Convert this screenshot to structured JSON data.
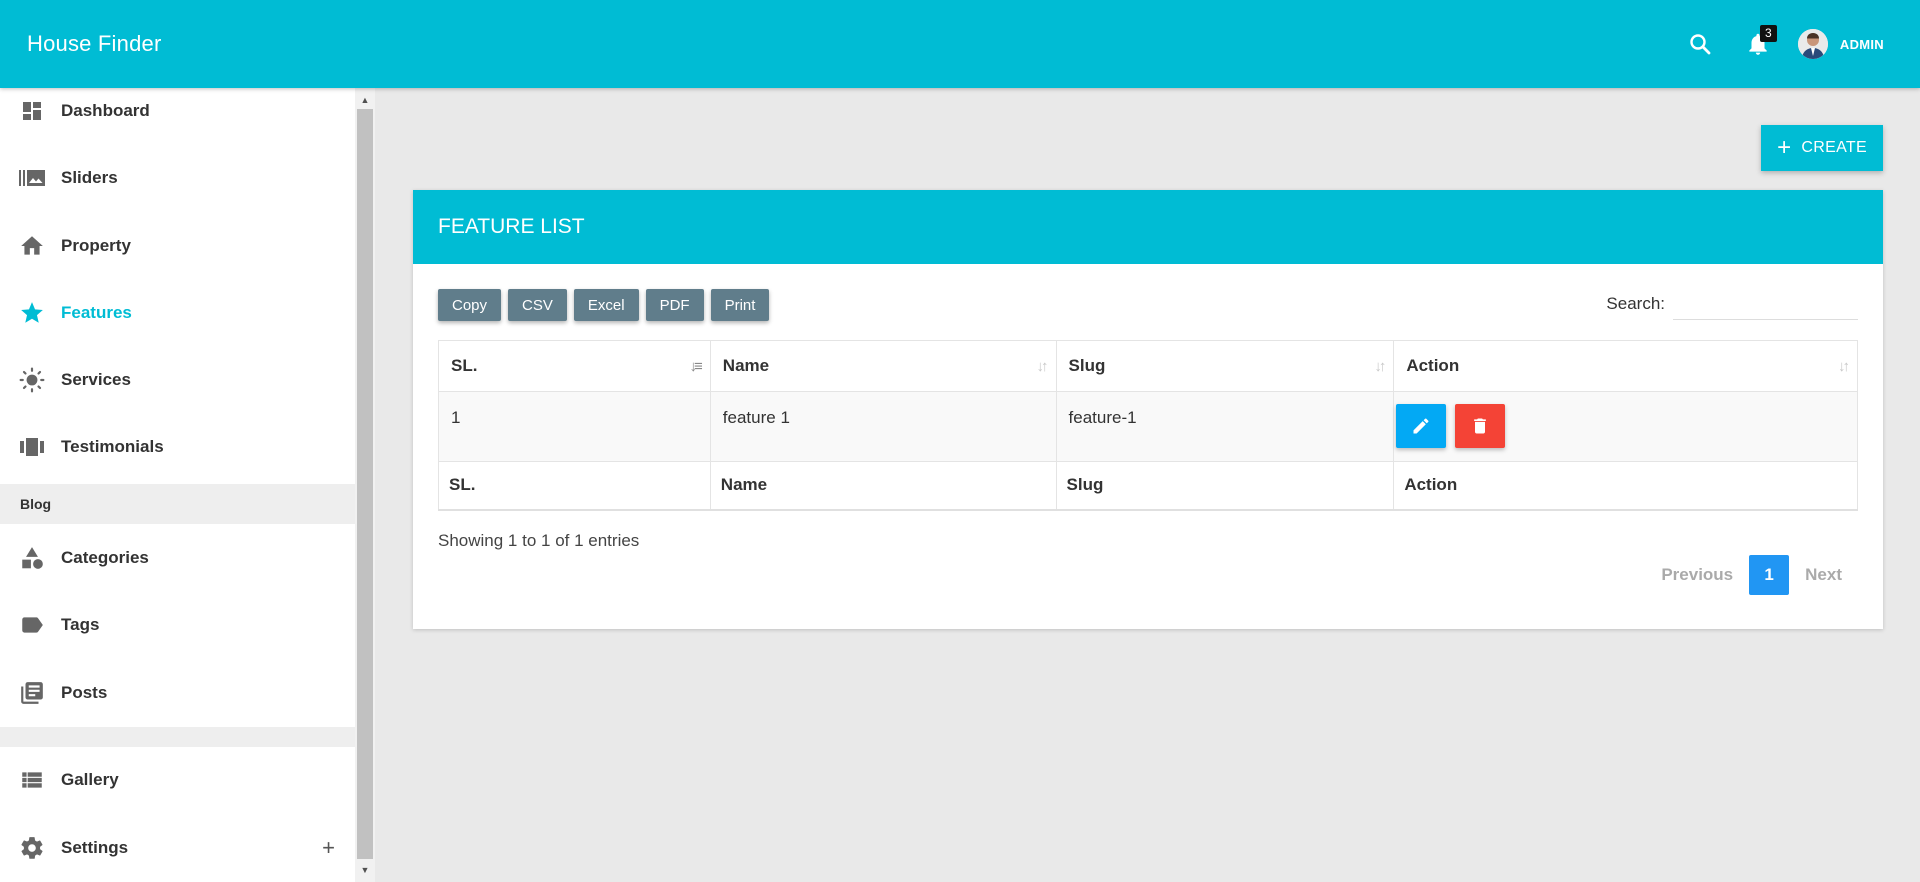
{
  "app": {
    "title": "House Finder"
  },
  "topbar": {
    "notification_count": "3",
    "user_label": "ADMIN"
  },
  "sidebar": {
    "items": [
      {
        "label": "Dashboard",
        "icon": "dashboard-icon"
      },
      {
        "label": "Sliders",
        "icon": "slider-icon"
      },
      {
        "label": "Property",
        "icon": "home-icon"
      },
      {
        "label": "Features",
        "icon": "star-icon",
        "active": true
      },
      {
        "label": "Services",
        "icon": "sun-icon"
      },
      {
        "label": "Testimonials",
        "icon": "carousel-icon"
      }
    ],
    "blog_header": "Blog",
    "blog_items": [
      {
        "label": "Categories",
        "icon": "category-icon"
      },
      {
        "label": "Tags",
        "icon": "tag-icon"
      },
      {
        "label": "Posts",
        "icon": "library-icon"
      }
    ],
    "bottom_items": [
      {
        "label": "Gallery",
        "icon": "list-icon"
      },
      {
        "label": "Settings",
        "icon": "gear-icon",
        "expand": "+"
      }
    ]
  },
  "main": {
    "create_label": "CREATE",
    "card_title": "FEATURE LIST",
    "export_buttons": [
      "Copy",
      "CSV",
      "Excel",
      "PDF",
      "Print"
    ],
    "search_label": "Search:",
    "search_value": "",
    "table": {
      "columns": [
        "SL.",
        "Name",
        "Slug",
        "Action"
      ],
      "rows": [
        {
          "sl": "1",
          "name": "feature 1",
          "slug": "feature-1"
        }
      ]
    },
    "info": "Showing 1 to 1 of 1 entries",
    "pagination": {
      "prev": "Previous",
      "current": "1",
      "next": "Next"
    }
  },
  "colors": {
    "primary": "#00bcd4",
    "export_button": "#607d8b",
    "edit": "#03a9f4",
    "delete": "#f44336",
    "page_active": "#2196f3"
  }
}
